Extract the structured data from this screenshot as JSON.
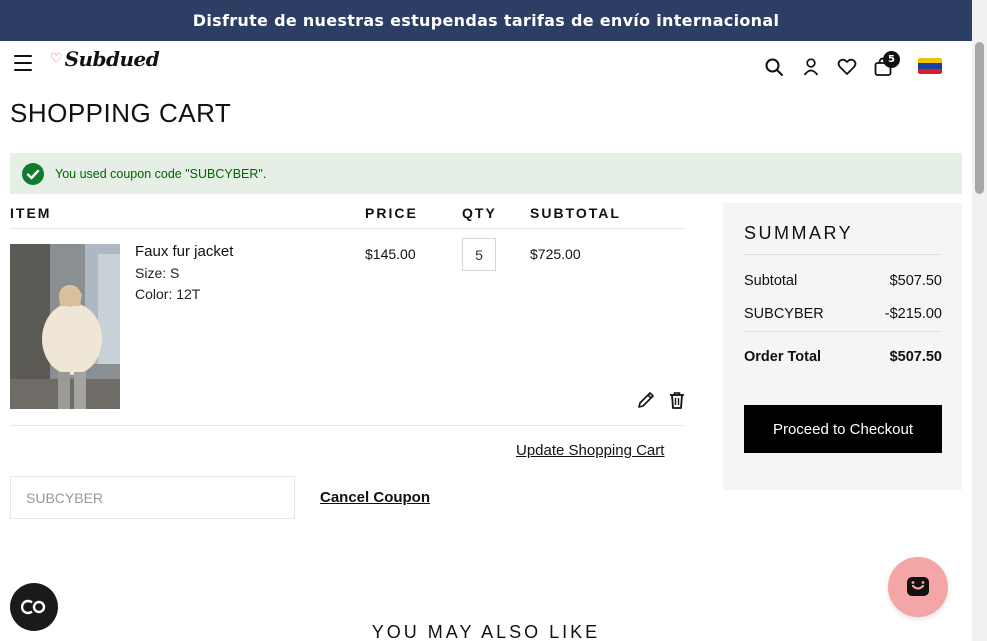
{
  "promo": {
    "text": "Disfrute de nuestras estupendas tarifas de envío internacional"
  },
  "brand": {
    "logo_text": "Subdued"
  },
  "header": {
    "cart_count": "5",
    "flag": "venezuela-flag-icon"
  },
  "page": {
    "title": "SHOPPING CART"
  },
  "coupon_message": {
    "text": "You used coupon code \"SUBCYBER\"."
  },
  "table": {
    "headers": {
      "item": "ITEM",
      "price": "PRICE",
      "qty": "QTY",
      "subtotal": "SUBTOTAL"
    },
    "items": [
      {
        "name": "Faux fur jacket",
        "size": "Size: S",
        "color": "Color: 12T",
        "price": "$145.00",
        "qty": "5",
        "subtotal": "$725.00"
      }
    ]
  },
  "actions": {
    "update_cart": "Update Shopping Cart",
    "cancel_coupon": "Cancel Coupon",
    "coupon_value": "SUBCYBER"
  },
  "summary": {
    "title": "SUMMARY",
    "subtotal_label": "Subtotal",
    "subtotal_value": "$507.50",
    "discount_label": "SUBCYBER",
    "discount_value": "-$215.00",
    "total_label": "Order Total",
    "total_value": "$507.50",
    "checkout_label": "Proceed to Checkout"
  },
  "recommendations": {
    "title": "YOU MAY ALSO LIKE"
  },
  "widgets": {
    "accessibility_label": "CO"
  },
  "colors": {
    "promo_bg": "#2c3e63",
    "success_bg": "#e5efe5",
    "success_text": "#006400",
    "chat_bg": "#f4a5a5",
    "logo_heart": "#e36b7c"
  }
}
